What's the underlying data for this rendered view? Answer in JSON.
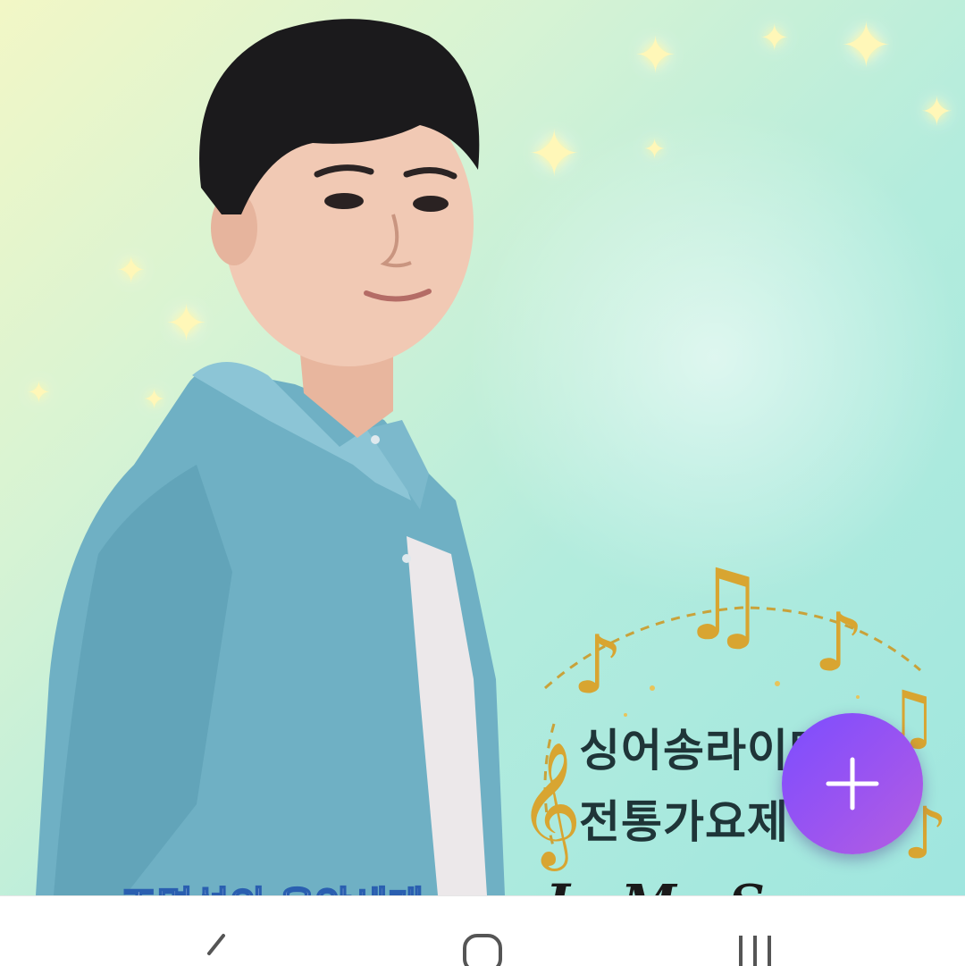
{
  "poster": {
    "title_line1": "싱어송라이터",
    "title_line2": "전통가요제",
    "bottom_left_text": "조명섭의 음악세계",
    "bottom_right_text": "J · M · S"
  },
  "fab": {
    "icon": "plus-icon"
  },
  "nav": {
    "back_icon": "back-icon",
    "home_icon": "home-icon",
    "recents_icon": "recents-icon"
  },
  "colors": {
    "fab": "#8b4fef",
    "gold": "#d8a531",
    "background": "#b3ecdd"
  }
}
